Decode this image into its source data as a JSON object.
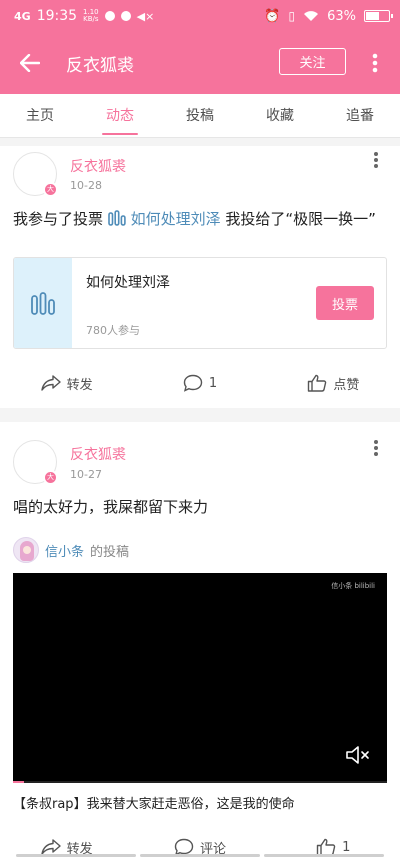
{
  "status_bar": {
    "network": "4G",
    "time": "19:35",
    "speed_value": "1.10",
    "speed_unit": "KB/s",
    "battery": "63%",
    "battery_level": 0.63
  },
  "header": {
    "title": "反衣狐裘",
    "follow_label": "关注"
  },
  "tabs": [
    {
      "label": "主页",
      "active": false
    },
    {
      "label": "动态",
      "active": true
    },
    {
      "label": "投稿",
      "active": false
    },
    {
      "label": "收藏",
      "active": false
    },
    {
      "label": "追番",
      "active": false
    }
  ],
  "posts": [
    {
      "author": "反衣狐裘",
      "date": "10-28",
      "badge": "大",
      "text_prefix": "我参与了投票",
      "text_link": "如何处理刘泽",
      "text_suffix": "我投给了“极限一换一”",
      "vote": {
        "title": "如何处理刘泽",
        "participants": "780人参与",
        "button_label": "投票"
      },
      "actions": {
        "repost": "转发",
        "comments": "1",
        "like": "点赞"
      }
    },
    {
      "author": "反衣狐裘",
      "date": "10-27",
      "badge": "大",
      "text": "唱的太好力，我屎都留下来力",
      "repost": {
        "uploader": "信小条",
        "suffix": "的投稿"
      },
      "video": {
        "watermark": "信小条 bilibili",
        "title": "【条叔rap】我来替大家赶走恶俗，这是我的使命",
        "progress": 0.03
      },
      "actions": {
        "repost": "转发",
        "comments": "评论",
        "like": "1"
      }
    }
  ],
  "colors": {
    "brand_pink": "#f6739c",
    "link_blue": "#4f8cb8",
    "vote_icon_bg": "#ddf1fb"
  }
}
